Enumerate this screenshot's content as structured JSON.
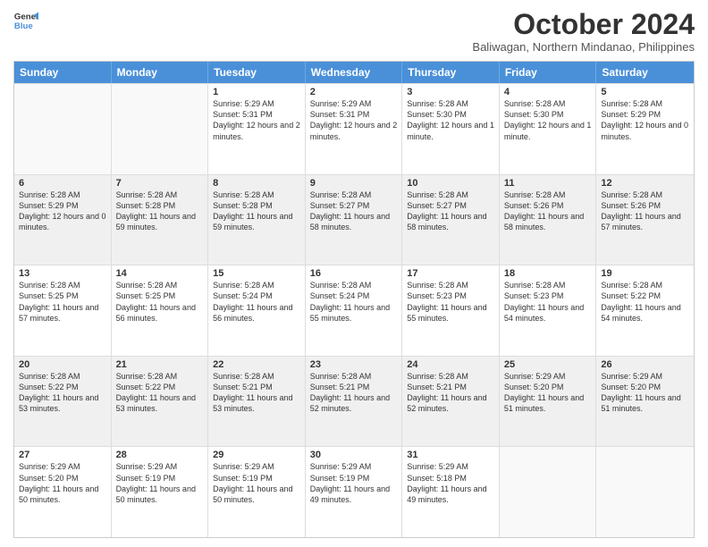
{
  "header": {
    "logo_line1": "General",
    "logo_line2": "Blue",
    "month": "October 2024",
    "location": "Baliwagan, Northern Mindanao, Philippines"
  },
  "days_of_week": [
    "Sunday",
    "Monday",
    "Tuesday",
    "Wednesday",
    "Thursday",
    "Friday",
    "Saturday"
  ],
  "rows": [
    [
      {
        "day": "",
        "text": "",
        "empty": true
      },
      {
        "day": "",
        "text": "",
        "empty": true
      },
      {
        "day": "1",
        "text": "Sunrise: 5:29 AM\nSunset: 5:31 PM\nDaylight: 12 hours and 2 minutes."
      },
      {
        "day": "2",
        "text": "Sunrise: 5:29 AM\nSunset: 5:31 PM\nDaylight: 12 hours and 2 minutes."
      },
      {
        "day": "3",
        "text": "Sunrise: 5:28 AM\nSunset: 5:30 PM\nDaylight: 12 hours and 1 minute."
      },
      {
        "day": "4",
        "text": "Sunrise: 5:28 AM\nSunset: 5:30 PM\nDaylight: 12 hours and 1 minute."
      },
      {
        "day": "5",
        "text": "Sunrise: 5:28 AM\nSunset: 5:29 PM\nDaylight: 12 hours and 0 minutes."
      }
    ],
    [
      {
        "day": "6",
        "text": "Sunrise: 5:28 AM\nSunset: 5:29 PM\nDaylight: 12 hours and 0 minutes."
      },
      {
        "day": "7",
        "text": "Sunrise: 5:28 AM\nSunset: 5:28 PM\nDaylight: 11 hours and 59 minutes."
      },
      {
        "day": "8",
        "text": "Sunrise: 5:28 AM\nSunset: 5:28 PM\nDaylight: 11 hours and 59 minutes."
      },
      {
        "day": "9",
        "text": "Sunrise: 5:28 AM\nSunset: 5:27 PM\nDaylight: 11 hours and 58 minutes."
      },
      {
        "day": "10",
        "text": "Sunrise: 5:28 AM\nSunset: 5:27 PM\nDaylight: 11 hours and 58 minutes."
      },
      {
        "day": "11",
        "text": "Sunrise: 5:28 AM\nSunset: 5:26 PM\nDaylight: 11 hours and 58 minutes."
      },
      {
        "day": "12",
        "text": "Sunrise: 5:28 AM\nSunset: 5:26 PM\nDaylight: 11 hours and 57 minutes."
      }
    ],
    [
      {
        "day": "13",
        "text": "Sunrise: 5:28 AM\nSunset: 5:25 PM\nDaylight: 11 hours and 57 minutes."
      },
      {
        "day": "14",
        "text": "Sunrise: 5:28 AM\nSunset: 5:25 PM\nDaylight: 11 hours and 56 minutes."
      },
      {
        "day": "15",
        "text": "Sunrise: 5:28 AM\nSunset: 5:24 PM\nDaylight: 11 hours and 56 minutes."
      },
      {
        "day": "16",
        "text": "Sunrise: 5:28 AM\nSunset: 5:24 PM\nDaylight: 11 hours and 55 minutes."
      },
      {
        "day": "17",
        "text": "Sunrise: 5:28 AM\nSunset: 5:23 PM\nDaylight: 11 hours and 55 minutes."
      },
      {
        "day": "18",
        "text": "Sunrise: 5:28 AM\nSunset: 5:23 PM\nDaylight: 11 hours and 54 minutes."
      },
      {
        "day": "19",
        "text": "Sunrise: 5:28 AM\nSunset: 5:22 PM\nDaylight: 11 hours and 54 minutes."
      }
    ],
    [
      {
        "day": "20",
        "text": "Sunrise: 5:28 AM\nSunset: 5:22 PM\nDaylight: 11 hours and 53 minutes."
      },
      {
        "day": "21",
        "text": "Sunrise: 5:28 AM\nSunset: 5:22 PM\nDaylight: 11 hours and 53 minutes."
      },
      {
        "day": "22",
        "text": "Sunrise: 5:28 AM\nSunset: 5:21 PM\nDaylight: 11 hours and 53 minutes."
      },
      {
        "day": "23",
        "text": "Sunrise: 5:28 AM\nSunset: 5:21 PM\nDaylight: 11 hours and 52 minutes."
      },
      {
        "day": "24",
        "text": "Sunrise: 5:28 AM\nSunset: 5:21 PM\nDaylight: 11 hours and 52 minutes."
      },
      {
        "day": "25",
        "text": "Sunrise: 5:29 AM\nSunset: 5:20 PM\nDaylight: 11 hours and 51 minutes."
      },
      {
        "day": "26",
        "text": "Sunrise: 5:29 AM\nSunset: 5:20 PM\nDaylight: 11 hours and 51 minutes."
      }
    ],
    [
      {
        "day": "27",
        "text": "Sunrise: 5:29 AM\nSunset: 5:20 PM\nDaylight: 11 hours and 50 minutes."
      },
      {
        "day": "28",
        "text": "Sunrise: 5:29 AM\nSunset: 5:19 PM\nDaylight: 11 hours and 50 minutes."
      },
      {
        "day": "29",
        "text": "Sunrise: 5:29 AM\nSunset: 5:19 PM\nDaylight: 11 hours and 50 minutes."
      },
      {
        "day": "30",
        "text": "Sunrise: 5:29 AM\nSunset: 5:19 PM\nDaylight: 11 hours and 49 minutes."
      },
      {
        "day": "31",
        "text": "Sunrise: 5:29 AM\nSunset: 5:18 PM\nDaylight: 11 hours and 49 minutes."
      },
      {
        "day": "",
        "text": "",
        "empty": true
      },
      {
        "day": "",
        "text": "",
        "empty": true
      }
    ]
  ]
}
